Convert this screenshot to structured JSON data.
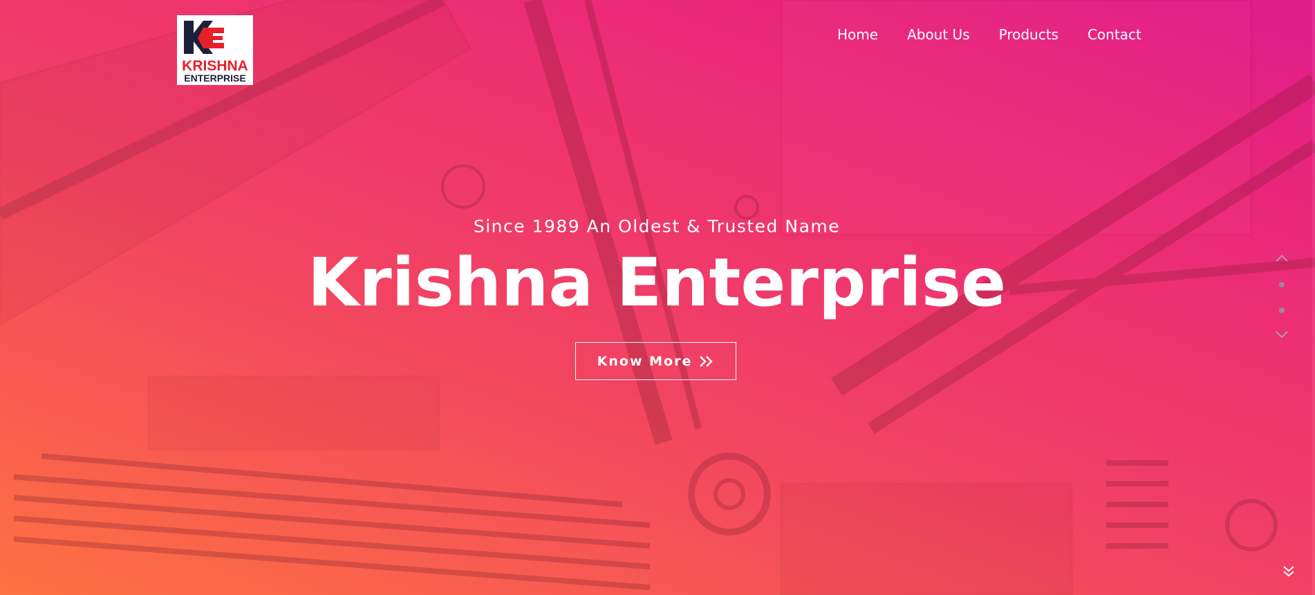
{
  "brand": {
    "logo_line1": "KRISHNA",
    "logo_line2": "ENTERPRISE",
    "colors": {
      "red": "#e8202a",
      "navy": "#1b1f3a"
    }
  },
  "nav": {
    "items": [
      {
        "label": "Home"
      },
      {
        "label": "About Us"
      },
      {
        "label": "Products"
      },
      {
        "label": "Contact"
      }
    ]
  },
  "hero": {
    "subtitle": "Since 1989 An Oldest & Trusted Name",
    "title": "Krishna Enterprise",
    "cta_label": "Know More",
    "cta_icon": "double-chevron-right-icon"
  },
  "slider": {
    "prev_icon": "chevron-up-icon",
    "next_icon": "chevron-down-icon",
    "dots": 2
  },
  "scroll_icon": "double-chevron-down-icon",
  "theme": {
    "gradient_start": "#ff763e",
    "gradient_mid": "#f44660",
    "gradient_end": "#e0188c"
  }
}
